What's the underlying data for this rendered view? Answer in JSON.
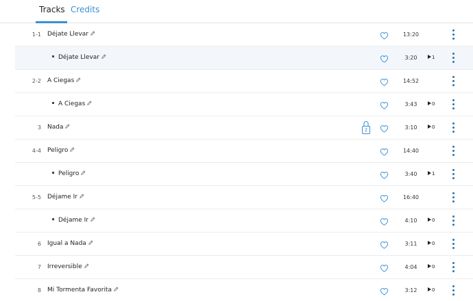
{
  "tabs": [
    {
      "label": "Tracks",
      "active": true
    },
    {
      "label": "Credits",
      "active": false
    }
  ],
  "colors": {
    "accent": "#3a8fd2",
    "more_icon": "#2a72ad",
    "row_highlight": "#f3f6fa"
  },
  "tracks": [
    {
      "num": "1-1",
      "title": "Déjate Llevar",
      "duration": "13:20",
      "plays": "",
      "sub": false,
      "highlight": false,
      "lock": ""
    },
    {
      "num": "",
      "title": "Déjate Llevar",
      "duration": "3:20",
      "plays": "1",
      "sub": true,
      "highlight": true,
      "lock": ""
    },
    {
      "num": "2-2",
      "title": "A Ciegas",
      "duration": "14:52",
      "plays": "",
      "sub": false,
      "highlight": false,
      "lock": ""
    },
    {
      "num": "",
      "title": "A Ciegas",
      "duration": "3:43",
      "plays": "0",
      "sub": true,
      "highlight": false,
      "lock": ""
    },
    {
      "num": "3",
      "title": "Nada",
      "duration": "3:10",
      "plays": "0",
      "sub": false,
      "highlight": false,
      "lock": "2"
    },
    {
      "num": "4-4",
      "title": "Peligro",
      "duration": "14:40",
      "plays": "",
      "sub": false,
      "highlight": false,
      "lock": ""
    },
    {
      "num": "",
      "title": "Peligro",
      "duration": "3:40",
      "plays": "1",
      "sub": true,
      "highlight": false,
      "lock": ""
    },
    {
      "num": "5-5",
      "title": "Déjame Ir",
      "duration": "16:40",
      "plays": "",
      "sub": false,
      "highlight": false,
      "lock": ""
    },
    {
      "num": "",
      "title": "Déjame Ir",
      "duration": "4:10",
      "plays": "0",
      "sub": true,
      "highlight": false,
      "lock": ""
    },
    {
      "num": "6",
      "title": "Igual a Nada",
      "duration": "3:11",
      "plays": "0",
      "sub": false,
      "highlight": false,
      "lock": ""
    },
    {
      "num": "7",
      "title": "Irreversible",
      "duration": "4:04",
      "plays": "0",
      "sub": false,
      "highlight": false,
      "lock": ""
    },
    {
      "num": "8",
      "title": "Mi Tormenta Favorita",
      "duration": "3:12",
      "plays": "0",
      "sub": false,
      "highlight": false,
      "lock": ""
    }
  ],
  "icons": {
    "edit": "pencil-icon",
    "favorite": "heart-icon",
    "play": "play-icon",
    "more": "more-vertical-icon",
    "lock": "lock-icon"
  }
}
